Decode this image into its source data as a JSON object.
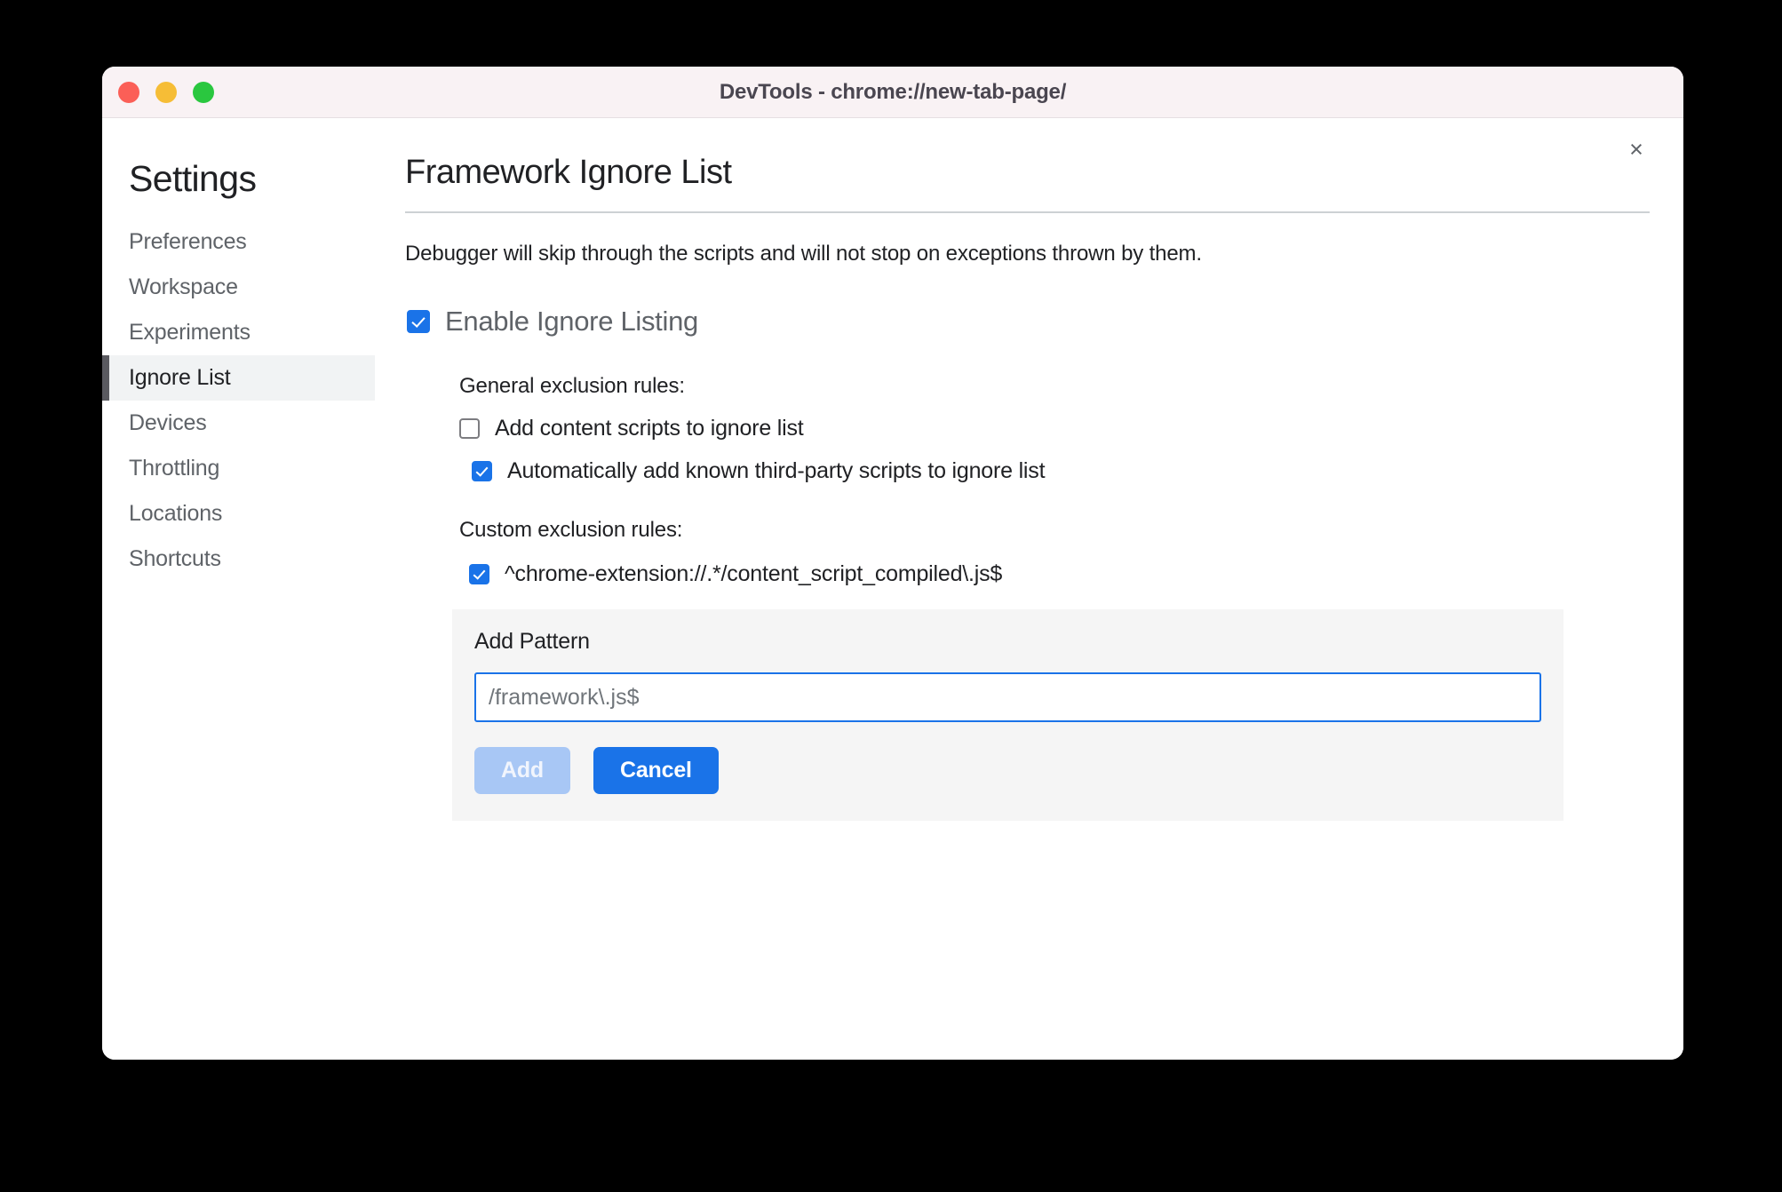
{
  "window": {
    "title": "DevTools - chrome://new-tab-page/",
    "traffic_lights": [
      {
        "name": "close",
        "color": "#fb5f57"
      },
      {
        "name": "minimize",
        "color": "#f6bd36"
      },
      {
        "name": "maximize",
        "color": "#2ac73f"
      }
    ]
  },
  "sidebar": {
    "heading": "Settings",
    "items": [
      {
        "label": "Preferences",
        "selected": false
      },
      {
        "label": "Workspace",
        "selected": false
      },
      {
        "label": "Experiments",
        "selected": false
      },
      {
        "label": "Ignore List",
        "selected": true
      },
      {
        "label": "Devices",
        "selected": false
      },
      {
        "label": "Throttling",
        "selected": false
      },
      {
        "label": "Locations",
        "selected": false
      },
      {
        "label": "Shortcuts",
        "selected": false
      }
    ]
  },
  "main": {
    "close_icon": "×",
    "title": "Framework Ignore List",
    "description": "Debugger will skip through the scripts and will not stop on exceptions thrown by them.",
    "enable_ignore_listing": {
      "label": "Enable Ignore Listing",
      "checked": true
    },
    "general_rules": {
      "label": "General exclusion rules:",
      "items": [
        {
          "label": "Add content scripts to ignore list",
          "checked": false
        },
        {
          "label": "Automatically add known third-party scripts to ignore list",
          "checked": true
        }
      ]
    },
    "custom_rules": {
      "label": "Custom exclusion rules:",
      "items": [
        {
          "label": "^chrome-extension://.*/content_script_compiled\\.js$",
          "checked": true
        }
      ]
    },
    "add_pattern": {
      "title": "Add Pattern",
      "input_value": "",
      "input_placeholder": "/framework\\.js$",
      "add_label": "Add",
      "add_disabled": true,
      "cancel_label": "Cancel"
    }
  },
  "colors": {
    "accent": "#1a73e8",
    "accent_disabled": "#a8c7f5",
    "selected_row_bg": "#f1f3f4",
    "selection_marker": "#5a5a60",
    "titlebar_bg": "#f9f2f4",
    "panel_bg": "#f5f5f5"
  }
}
